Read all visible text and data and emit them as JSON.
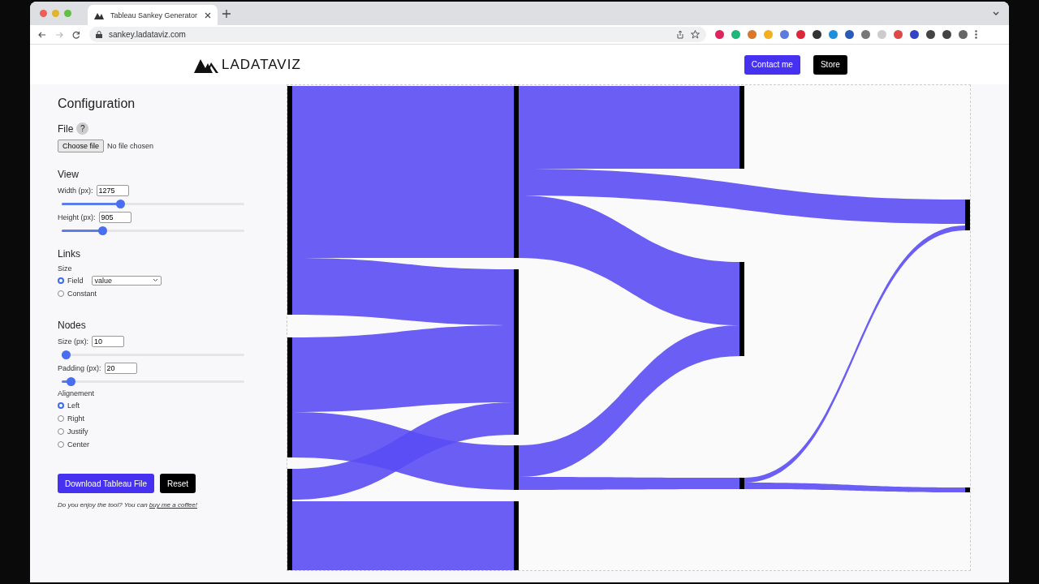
{
  "browser": {
    "tab_title": "Tableau Sankey Generator",
    "url": "sankey.ladataviz.com"
  },
  "header": {
    "logo": "LADATAVIZ",
    "buttons": [
      {
        "label": "Contact me",
        "kind": "primary"
      },
      {
        "label": "Store",
        "kind": "dark"
      }
    ]
  },
  "configuration": {
    "title": "Configuration",
    "file": {
      "heading": "File",
      "help": "?",
      "button": "Choose file",
      "status": "No file chosen"
    },
    "view": {
      "heading": "View",
      "fields": [
        {
          "label": "Width (px):",
          "value": "1275",
          "level": 0.32
        },
        {
          "label": "Height (px):",
          "value": "905",
          "level": 0.22
        }
      ]
    },
    "links": {
      "heading": "Links",
      "size_label": "Size",
      "options": [
        {
          "label": "Field",
          "selected": true,
          "select_value": "value"
        },
        {
          "label": "Constant",
          "selected": false
        }
      ]
    },
    "nodes": {
      "heading": "Nodes",
      "fields": [
        {
          "label": "Size (px):",
          "value": "10",
          "level": 0.02
        },
        {
          "label": "Padding (px):",
          "value": "20",
          "level": 0.05
        }
      ],
      "alignment_label": "Alignement",
      "alignments": [
        {
          "label": "Left",
          "selected": true
        },
        {
          "label": "Right",
          "selected": false
        },
        {
          "label": "Justify",
          "selected": false
        },
        {
          "label": "Center",
          "selected": false
        }
      ]
    },
    "buttons": [
      {
        "label": "Download Tableau File",
        "kind": "primary"
      },
      {
        "label": "Reset",
        "kind": "dark"
      }
    ],
    "footer": {
      "text": "Do you enjoy the tool? You can ",
      "link": "buy me a coffee!"
    }
  }
}
